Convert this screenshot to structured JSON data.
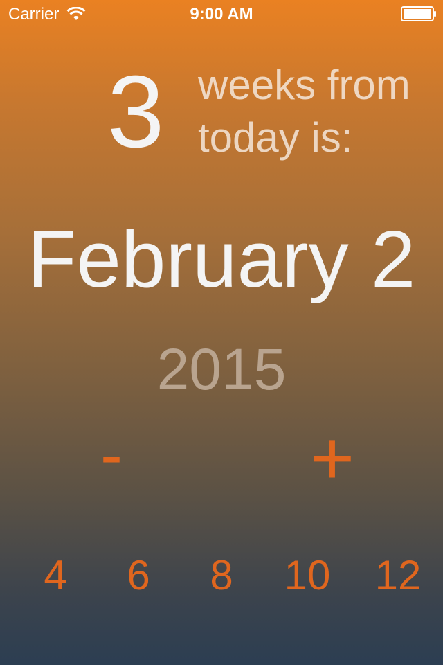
{
  "status_bar": {
    "carrier": "Carrier",
    "time": "9:00 AM",
    "icons": [
      "wifi-icon",
      "battery-icon"
    ]
  },
  "header": {
    "weeks_value": "3",
    "label_line1": "weeks from",
    "label_line2": "today is:"
  },
  "result": {
    "date": "February 2",
    "year": "2015"
  },
  "controls": {
    "minus_label": "-",
    "plus_label": "+"
  },
  "week_options": [
    "4",
    "6",
    "8",
    "10",
    "12"
  ],
  "colors": {
    "accent": "#e0661e",
    "text_primary": "#f4f4f4",
    "year_text": "#b9a48f",
    "gradient_top": "#ea8122",
    "gradient_bottom": "#2c3e52"
  }
}
